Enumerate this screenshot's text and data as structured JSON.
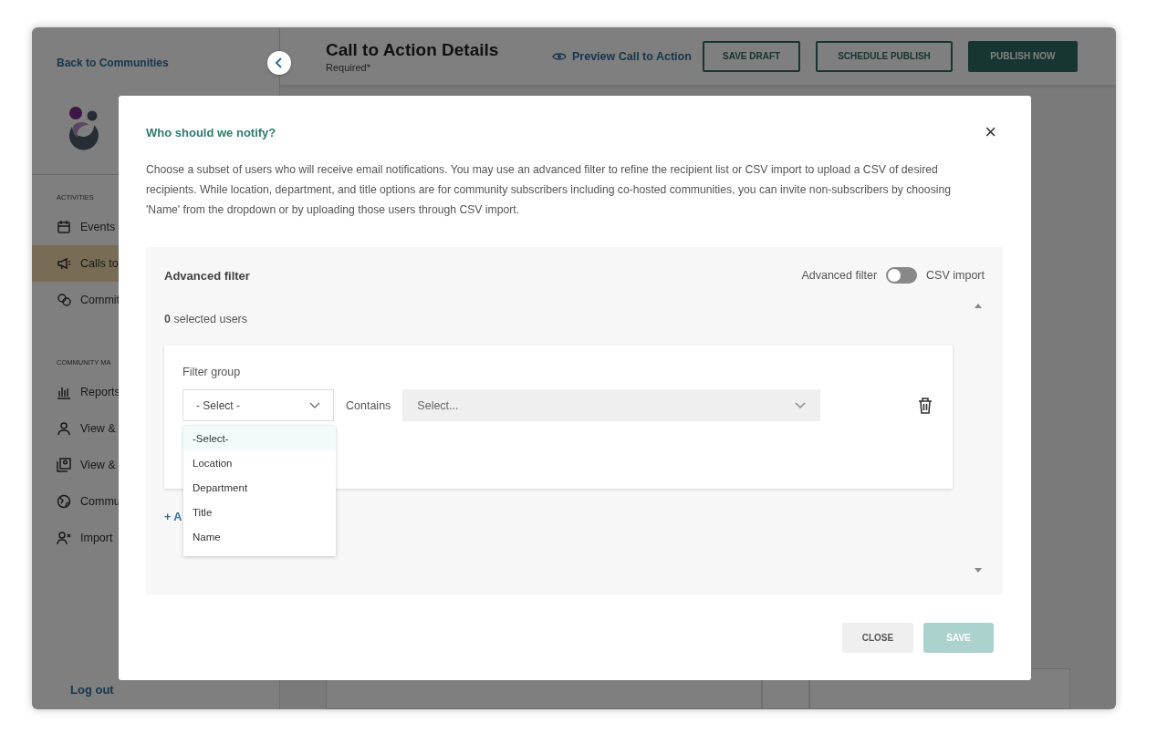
{
  "sidebar": {
    "back_link": "Back to Communities",
    "sections": [
      {
        "heading": "ACTIVITIES",
        "items": [
          {
            "label": "Events",
            "selected": false
          },
          {
            "label": "Calls to",
            "selected": true
          },
          {
            "label": "Commit",
            "selected": false
          }
        ]
      },
      {
        "heading": "COMMUNITY MA",
        "items": [
          {
            "label": "Reports",
            "selected": false
          },
          {
            "label": "View &",
            "selected": false
          },
          {
            "label": "View &",
            "selected": false
          },
          {
            "label": "Commu",
            "selected": false
          },
          {
            "label": "Import",
            "selected": false
          }
        ]
      }
    ],
    "logout": "Log out"
  },
  "header": {
    "title": "Call to Action Details",
    "subtitle": "Required*",
    "preview_link": "Preview Call to Action",
    "buttons": [
      {
        "label": "SAVE DRAFT",
        "kind": "outline"
      },
      {
        "label": "SCHEDULE PUBLISH",
        "kind": "outline"
      },
      {
        "label": "PUBLISH NOW",
        "kind": "filled"
      }
    ]
  },
  "modal": {
    "title": "Who should we notify?",
    "close": "×",
    "description": "Choose a subset of users who will receive email notifications. You may use an advanced filter to refine the recipient list or CSV import to upload a CSV of desired recipients. While location, department, and title options are for community subscribers including co-hosted communities, you can invite non-subscribers by choosing 'Name' from the dropdown or by uploading those users through CSV import.",
    "panel": {
      "title": "Advanced filter",
      "toggle": {
        "left_label": "Advanced filter",
        "right_label": "CSV import",
        "on": false
      },
      "selected_count": "**0** selected users",
      "filter_group": {
        "label": "Filter group",
        "field_select": "- Select -",
        "operator": "Contains",
        "value_placeholder": "Select...",
        "dropdown": [
          {
            "label": "-Select-",
            "selected": true
          },
          {
            "label": "Location",
            "selected": false
          },
          {
            "label": "Department",
            "selected": false
          },
          {
            "label": "Title",
            "selected": false
          },
          {
            "label": "Name",
            "selected": false
          }
        ]
      },
      "add_link": "+ A"
    },
    "buttons": [
      {
        "label": "CLOSE",
        "kind": "secondary",
        "disabled": false
      },
      {
        "label": "SAVE",
        "kind": "primary",
        "disabled": true
      }
    ]
  }
}
